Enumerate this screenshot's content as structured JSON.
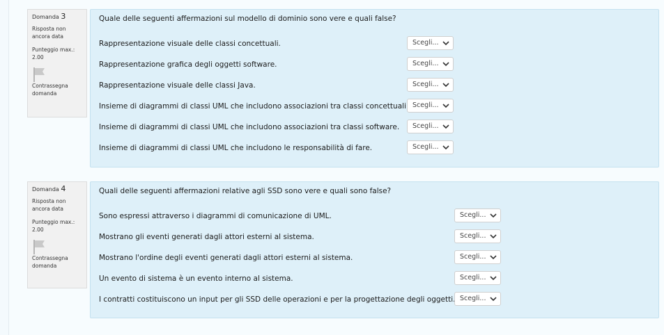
{
  "questions": [
    {
      "label": "Domanda",
      "number": "3",
      "state": "Risposta non ancora data",
      "grade": "Punteggio max.: 2.00",
      "flag_label": "Contrassegna domanda",
      "text": "Quale delle seguenti affermazioni sul modello di dominio sono vere e quali false?",
      "items": [
        {
          "label": "Rappresentazione visuale delle classi concettuali.",
          "select": "Scegli..."
        },
        {
          "label": "Rappresentazione grafica degli oggetti software.",
          "select": "Scegli..."
        },
        {
          "label": "Rappresentazione visuale delle classi Java.",
          "select": "Scegli..."
        },
        {
          "label": "Insieme di diagrammi di classi UML che includono associazioni tra classi concettuali.",
          "select": "Scegli..."
        },
        {
          "label": "Insieme di diagrammi di classi UML che includono associazioni tra classi software.",
          "select": "Scegli..."
        },
        {
          "label": "Insieme di diagrammi di classi UML che includono le responsabilità di fare.",
          "select": "Scegli..."
        }
      ]
    },
    {
      "label": "Domanda",
      "number": "4",
      "state": "Risposta non ancora data",
      "grade": "Punteggio max.: 2.00",
      "flag_label": "Contrassegna domanda",
      "text": "Quali delle seguenti affermazioni relative agli SSD sono vere e quali sono false?",
      "items": [
        {
          "label": "Sono espressi attraverso i diagrammi di comunicazione di UML.",
          "select": "Scegli..."
        },
        {
          "label": "Mostrano gli eventi generati dagli attori esterni al sistema.",
          "select": "Scegli..."
        },
        {
          "label": "Mostrano l'ordine degli eventi generati dagli attori esterni al sistema.",
          "select": "Scegli..."
        },
        {
          "label": "Un evento di sistema è un evento interno al sistema.",
          "select": "Scegli..."
        },
        {
          "label": "I contratti costituiscono un input per gli SSD delle operazioni e per la progettazione degli oggetti.",
          "select": "Scegli..."
        }
      ]
    }
  ]
}
